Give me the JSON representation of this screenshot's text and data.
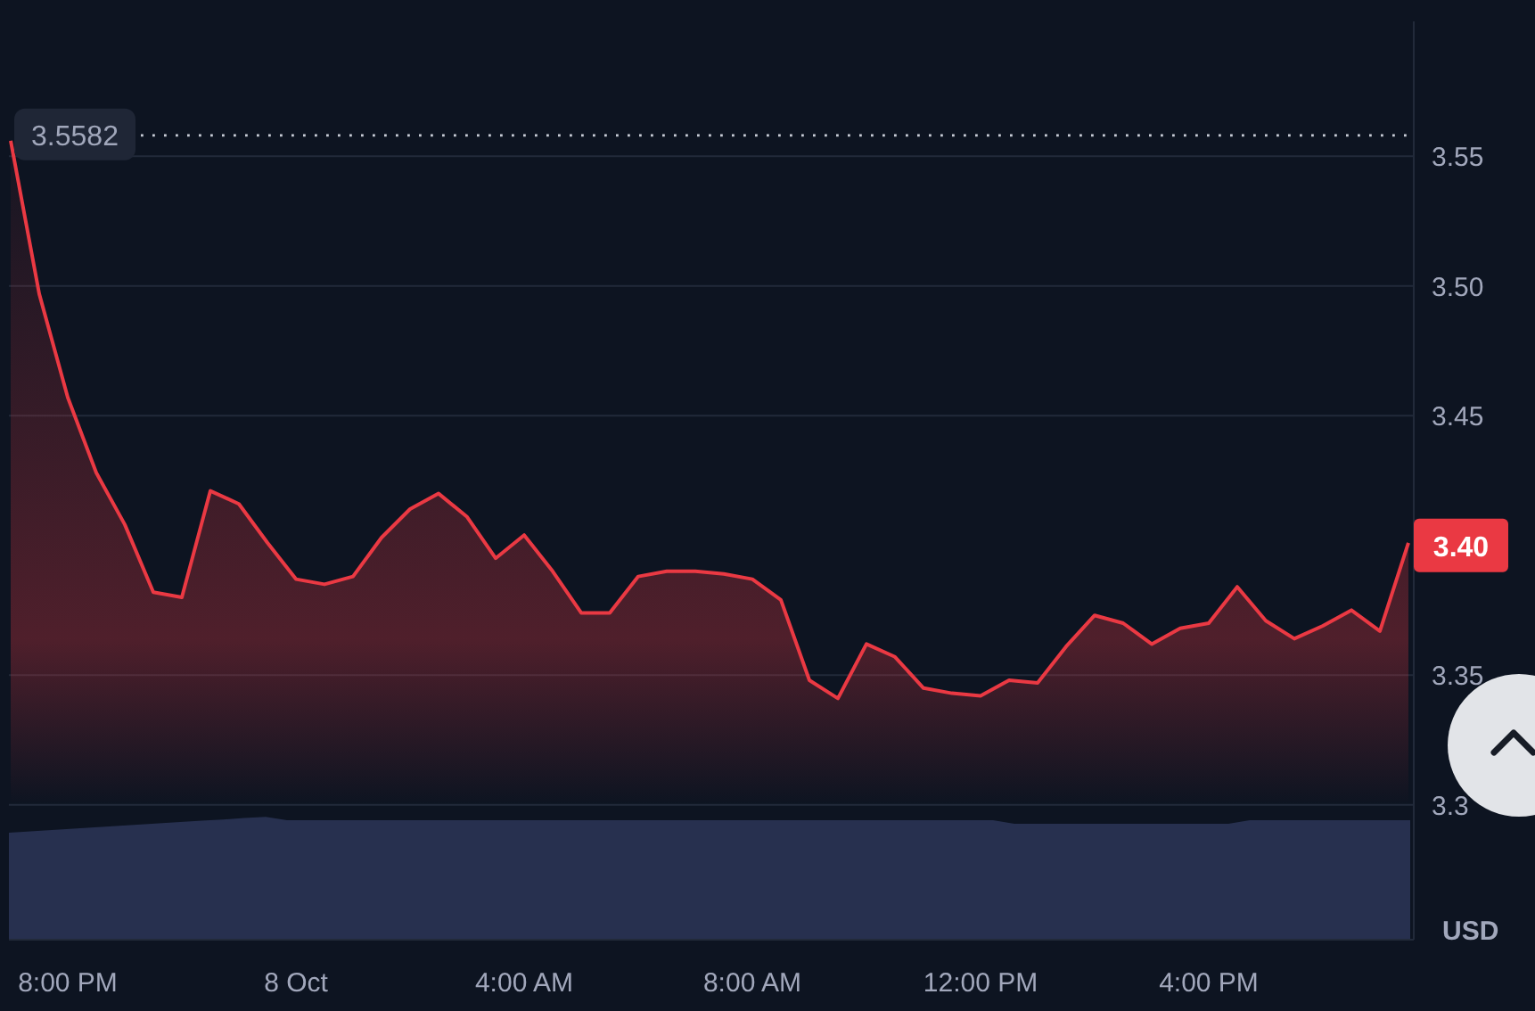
{
  "chart": {
    "chart_data": {
      "type": "area",
      "categories": [
        null,
        null,
        "8:00 PM",
        null,
        null,
        null,
        null,
        null,
        null,
        null,
        "8 Oct",
        null,
        null,
        null,
        null,
        null,
        null,
        null,
        "4:00 AM",
        null,
        null,
        null,
        null,
        null,
        null,
        null,
        "8:00 AM",
        null,
        null,
        null,
        null,
        null,
        null,
        null,
        "12:00 PM",
        null,
        null,
        null,
        null,
        null,
        null,
        null,
        "4:00 PM",
        null,
        null,
        null,
        null,
        null,
        null,
        null
      ],
      "series": [
        {
          "color": "#ea3943",
          "values": [
            3.556,
            3.497,
            3.457,
            3.428,
            3.408,
            3.382,
            3.38,
            3.421,
            3.416,
            3.401,
            3.387,
            3.385,
            3.388,
            3.403,
            3.414,
            3.42,
            3.411,
            3.395,
            3.404,
            3.39,
            3.374,
            3.374,
            3.388,
            3.39,
            3.39,
            3.389,
            3.387,
            3.379,
            3.348,
            3.341,
            3.362,
            3.357,
            3.345,
            3.343,
            3.342,
            3.348,
            3.347,
            3.361,
            3.373,
            3.37,
            3.362,
            3.368,
            3.37,
            3.384,
            3.371,
            3.364,
            3.369,
            3.375,
            3.367,
            3.401
          ]
        }
      ],
      "ylim": [
        3.248,
        3.602
      ],
      "grid": true,
      "yticks": [
        {
          "value": 3.3,
          "label": "3.3"
        },
        {
          "value": 3.35,
          "label": "3.35"
        },
        {
          "value": 3.45,
          "label": "3.45"
        },
        {
          "value": 3.5,
          "label": "3.50"
        },
        {
          "value": 3.55,
          "label": "3.55"
        }
      ]
    },
    "open_price": "3.5582",
    "last_price": "3.40",
    "unit": "USD"
  }
}
